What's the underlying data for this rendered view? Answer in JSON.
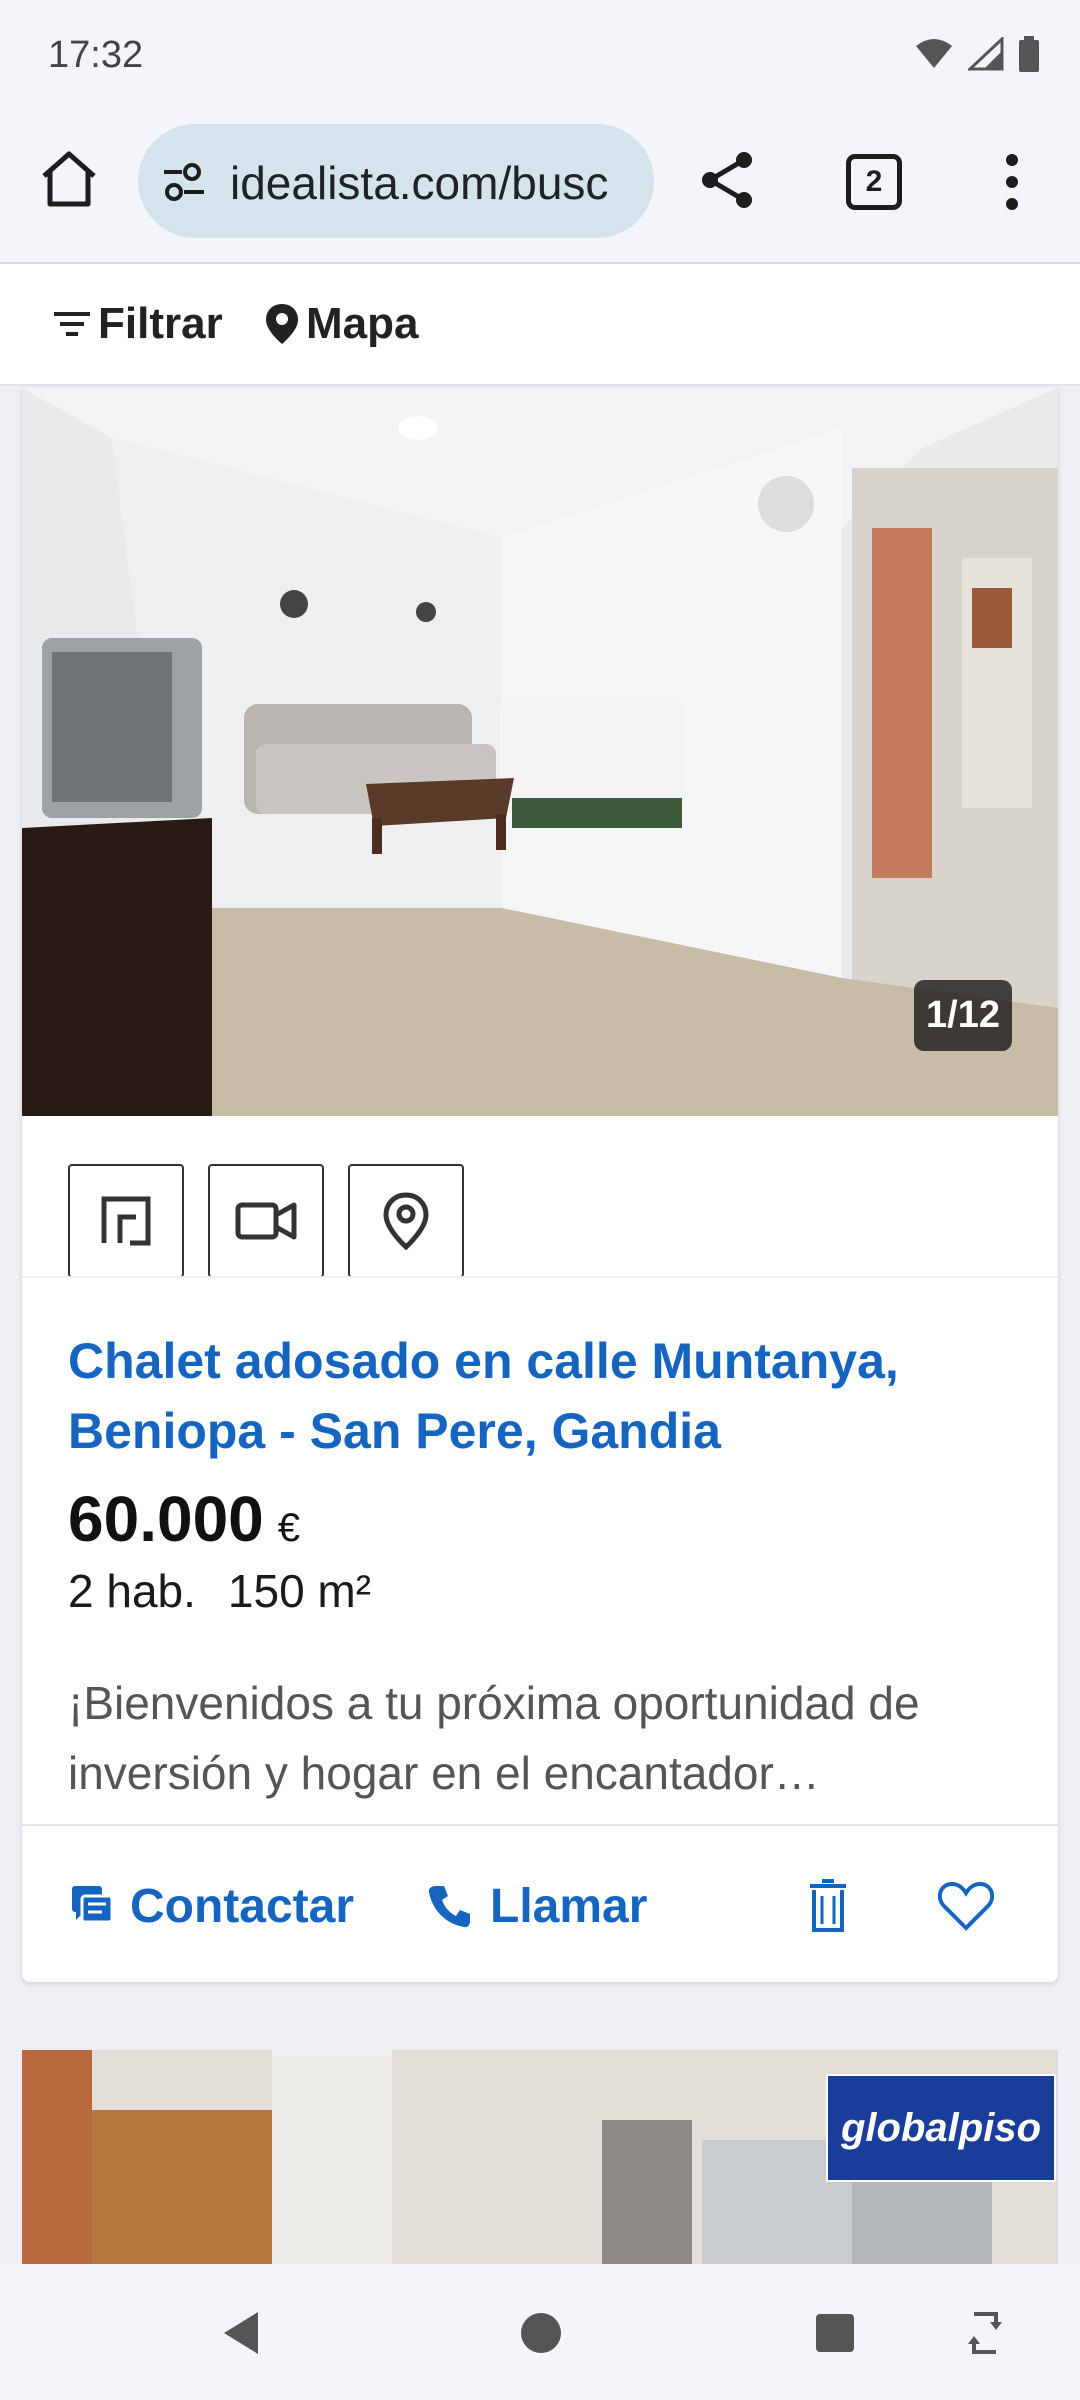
{
  "status_bar": {
    "time": "17:32",
    "icons": [
      "wifi-icon",
      "signal-icon",
      "battery-icon"
    ]
  },
  "browser": {
    "url": "idealista.com/busc",
    "tab_count": "2",
    "icons": [
      "home-icon",
      "site-settings-icon",
      "share-icon",
      "more-vert-icon"
    ]
  },
  "filter_bar": {
    "filter_label": "Filtrar",
    "map_label": "Mapa"
  },
  "listing": {
    "photo_counter": "1/12",
    "feature_icons": [
      "floor-plan-icon",
      "video-icon",
      "location-pin-icon"
    ],
    "title": "Chalet adosado en calle Muntanya, Beniopa - San Pere, Gandia",
    "price": "60.000",
    "currency": "€",
    "rooms": "2 hab.",
    "area": "150 m²",
    "description": "¡Bienvenidos a tu próxima oportunidad de inversión y hogar en el encantador…",
    "actions": {
      "contact_label": "Contactar",
      "call_label": "Llamar"
    }
  },
  "next_listing": {
    "agency_logo_text": "globalpiso"
  },
  "colors": {
    "link_blue": "#1565c0",
    "url_pill": "#d5e4ec",
    "agency_blue": "#1b3d9a"
  }
}
